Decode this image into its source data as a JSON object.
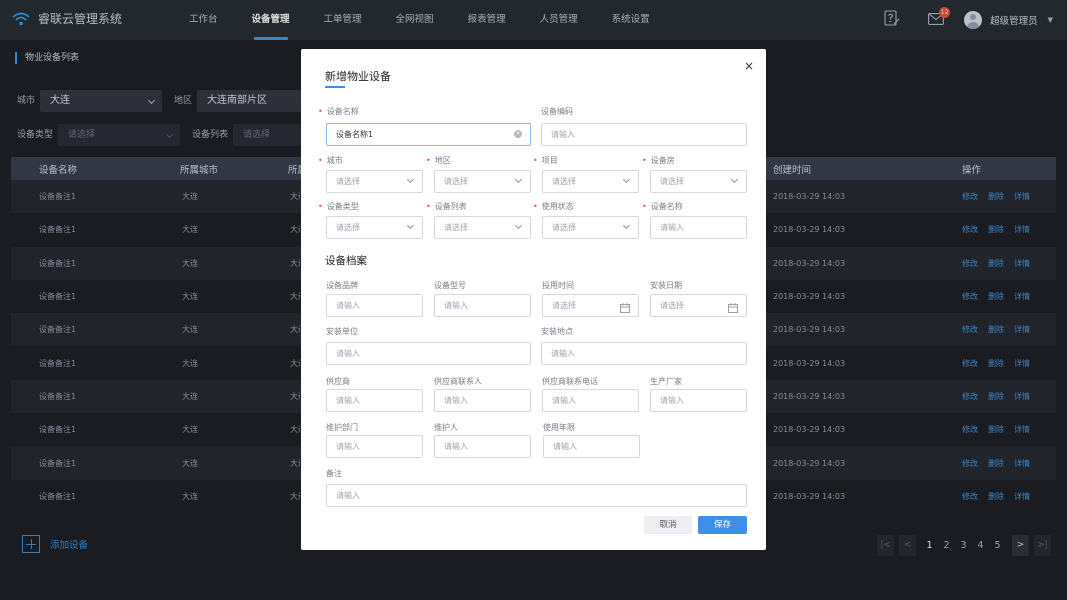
{
  "app": {
    "name": "睿联云管理系统"
  },
  "nav": [
    "工作台",
    "设备管理",
    "工单管理",
    "全网视图",
    "报表管理",
    "人员管理",
    "系统设置"
  ],
  "header": {
    "badge_count": "12",
    "user_name": "超级管理员"
  },
  "breadcrumb": "物业设备列表",
  "filters": {
    "city_label": "城市",
    "city_value": "大连",
    "area_label": "地区",
    "area_value": "大连南部片区",
    "type_label": "设备类型",
    "type_placeholder": "请选择",
    "list_label": "设备列表",
    "list_placeholder": "请选择"
  },
  "table": {
    "col_name": "设备名称",
    "col_city": "所属城市",
    "col_created": "创建时间",
    "col_ops": "操作",
    "op_edit": "修改",
    "op_delete": "删除",
    "op_detail": "详情",
    "rows": [
      {
        "name": "设备备注1",
        "city": "大连",
        "area": "大连",
        "created": "2018-03-29 14:03"
      },
      {
        "name": "设备备注1",
        "city": "大连",
        "area": "大连",
        "created": "2018-03-29 14:03"
      },
      {
        "name": "设备备注1",
        "city": "大连",
        "area": "大连",
        "created": "2018-03-29 14:03"
      },
      {
        "name": "设备备注1",
        "city": "大连",
        "area": "大连",
        "created": "2018-03-29 14:03"
      },
      {
        "name": "设备备注1",
        "city": "大连",
        "area": "大连",
        "created": "2018-03-29 14:03"
      },
      {
        "name": "设备备注1",
        "city": "大连",
        "area": "大连",
        "created": "2018-03-29 14:03"
      },
      {
        "name": "设备备注1",
        "city": "大连",
        "area": "大连",
        "created": "2018-03-29 14:03"
      },
      {
        "name": "设备备注1",
        "city": "大连",
        "area": "大连",
        "created": "2018-03-29 14:03"
      },
      {
        "name": "设备备注1",
        "city": "大连",
        "area": "大连",
        "created": "2018-03-29 14:03"
      },
      {
        "name": "设备备注1",
        "city": "大连",
        "area": "大连",
        "created": "2018-03-29 14:03"
      }
    ]
  },
  "add_button": "添加设备",
  "pagination": {
    "first": "|<",
    "prev": "<",
    "pages": [
      "1",
      "2",
      "3",
      "4",
      "5"
    ],
    "current": "1",
    "next": ">",
    "last": ">|"
  },
  "modal": {
    "title": "新增物业设备",
    "close": "×",
    "device_name_label": "设备名称",
    "device_name_value": "设备名称1",
    "device_code_label": "设备编码",
    "device_code_placeholder": "请输入",
    "city_label": "城市",
    "area_label": "地区",
    "project_label": "项目",
    "room_label": "设备房",
    "type_label": "设备类型",
    "list_label": "设备列表",
    "status_label": "使用状态",
    "name2_label": "设备名称",
    "select_placeholder": "请选择",
    "input_placeholder": "请输入",
    "archive_title": "设备档案",
    "brand_label": "设备品牌",
    "model_label": "设备型号",
    "use_time_label": "投用时间",
    "install_date_label": "安装日期",
    "install_unit_label": "安装单位",
    "install_place_label": "安装地点",
    "supplier_label": "供应商",
    "supplier_contact_label": "供应商联系人",
    "supplier_phone_label": "供应商联系电话",
    "manufacturer_label": "生产厂家",
    "maint_dept_label": "维护部门",
    "maintainer_label": "维护人",
    "years_label": "使用年限",
    "remark_label": "备注",
    "cancel": "取消",
    "save": "保存"
  },
  "colors": {
    "accent": "#36a3f7",
    "header_bg": "#2a2e37",
    "page_bg": "#1f2229",
    "primary_button": "#3f8fe8",
    "required": "#f05050"
  }
}
